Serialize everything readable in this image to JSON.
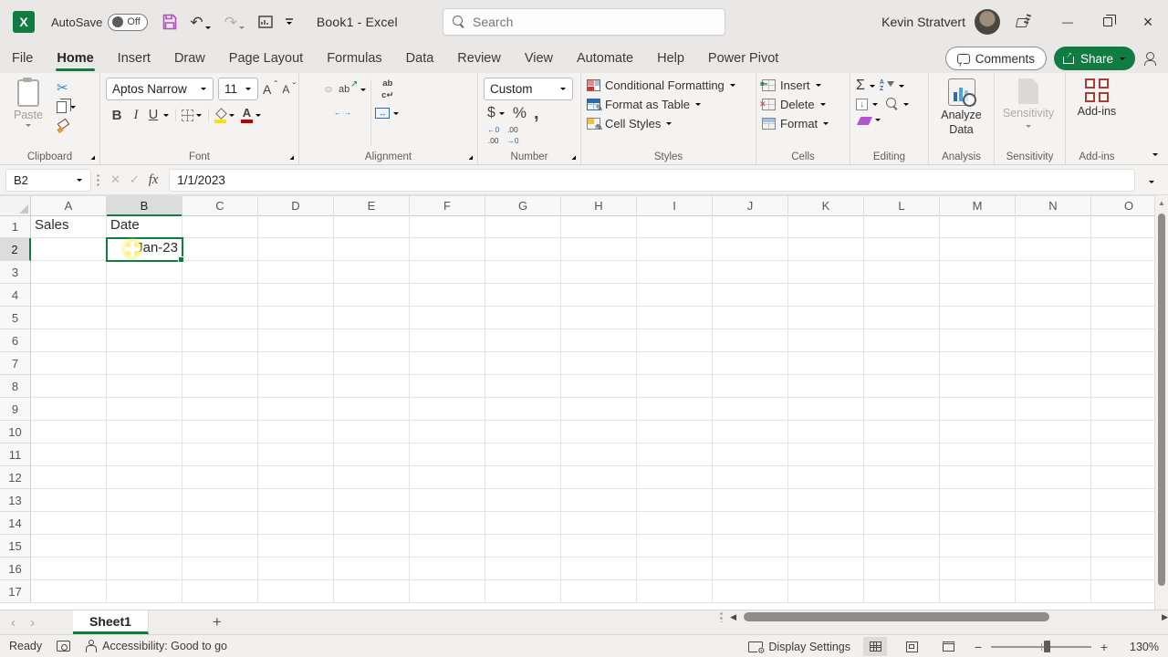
{
  "titlebar": {
    "autosave_label": "AutoSave",
    "autosave_state": "Off",
    "doc_title": "Book1 - Excel",
    "search_placeholder": "Search",
    "user_name": "Kevin Stratvert",
    "undo_glyph": "↶",
    "redo_glyph": "↷",
    "minimize_glyph": "—",
    "close_glyph": "×"
  },
  "ribbon_tabs": {
    "items": [
      "File",
      "Home",
      "Insert",
      "Draw",
      "Page Layout",
      "Formulas",
      "Data",
      "Review",
      "View",
      "Automate",
      "Help",
      "Power Pivot"
    ],
    "active": "Home",
    "comments_label": "Comments",
    "share_label": "Share"
  },
  "ribbon": {
    "clipboard": {
      "paste": "Paste",
      "cut_glyph": "✂",
      "group": "Clipboard"
    },
    "font": {
      "name": "Aptos Narrow",
      "size": "11",
      "bold": "B",
      "italic": "I",
      "underline": "U",
      "grow": "A",
      "shrink": "A",
      "color_letter": "A",
      "group": "Font"
    },
    "alignment": {
      "wrap_top": "ab",
      "wrap_bottom": "c↵",
      "orient": "ab",
      "merge_glyph": "↔",
      "group": "Alignment"
    },
    "number": {
      "format": "Custom",
      "currency": "$",
      "percent": "%",
      "comma": ",",
      "inc_top": "←0",
      "inc_bottom": ".00",
      "dec_top": ".00",
      "dec_bottom": "→0",
      "group": "Number"
    },
    "styles": {
      "conditional_formatting": "Conditional Formatting",
      "format_as_table": "Format as Table",
      "cell_styles": "Cell Styles",
      "group": "Styles"
    },
    "cells": {
      "insert": "Insert",
      "delete": "Delete",
      "format": "Format",
      "group": "Cells"
    },
    "editing": {
      "sum_glyph": "Σ",
      "sort_a": "A",
      "sort_z": "Z",
      "fill_glyph": "↓",
      "group": "Editing"
    },
    "analysis": {
      "analyze_data": "Analyze Data",
      "group": "Analysis"
    },
    "sensitivity": {
      "label": "Sensitivity",
      "group": "Sensitivity"
    },
    "addins": {
      "label": "Add-ins",
      "group": "Add-ins"
    }
  },
  "formula_bar": {
    "name_box": "B2",
    "cancel_glyph": "✕",
    "enter_glyph": "✓",
    "fx_label": "fx",
    "value": "1/1/2023"
  },
  "sheet": {
    "columns": [
      "A",
      "B",
      "C",
      "D",
      "E",
      "F",
      "G",
      "H",
      "I",
      "J",
      "K",
      "L",
      "M",
      "N",
      "O"
    ],
    "row_count": 17,
    "cells": {
      "A1": "Sales",
      "B1": "Date",
      "B2": "Jan-23"
    },
    "selection": "B2"
  },
  "sheet_tabs": {
    "prev_glyph": "‹",
    "next_glyph": "›",
    "active": "Sheet1",
    "add_glyph": "+",
    "scroll_left_glyph": "◀",
    "scroll_right_glyph": "▶"
  },
  "statusbar": {
    "mode": "Ready",
    "accessibility": "Accessibility: Good to go",
    "display_settings": "Display Settings",
    "zoom_out_glyph": "−",
    "zoom_in_glyph": "+",
    "zoom_level": "130%"
  },
  "colors": {
    "accent_green": "#107C41",
    "fill_color_swatch": "#FFE100",
    "font_color_swatch": "#C00000",
    "addins_red": "#B3392F",
    "eraser_purple": "#B255D0"
  }
}
